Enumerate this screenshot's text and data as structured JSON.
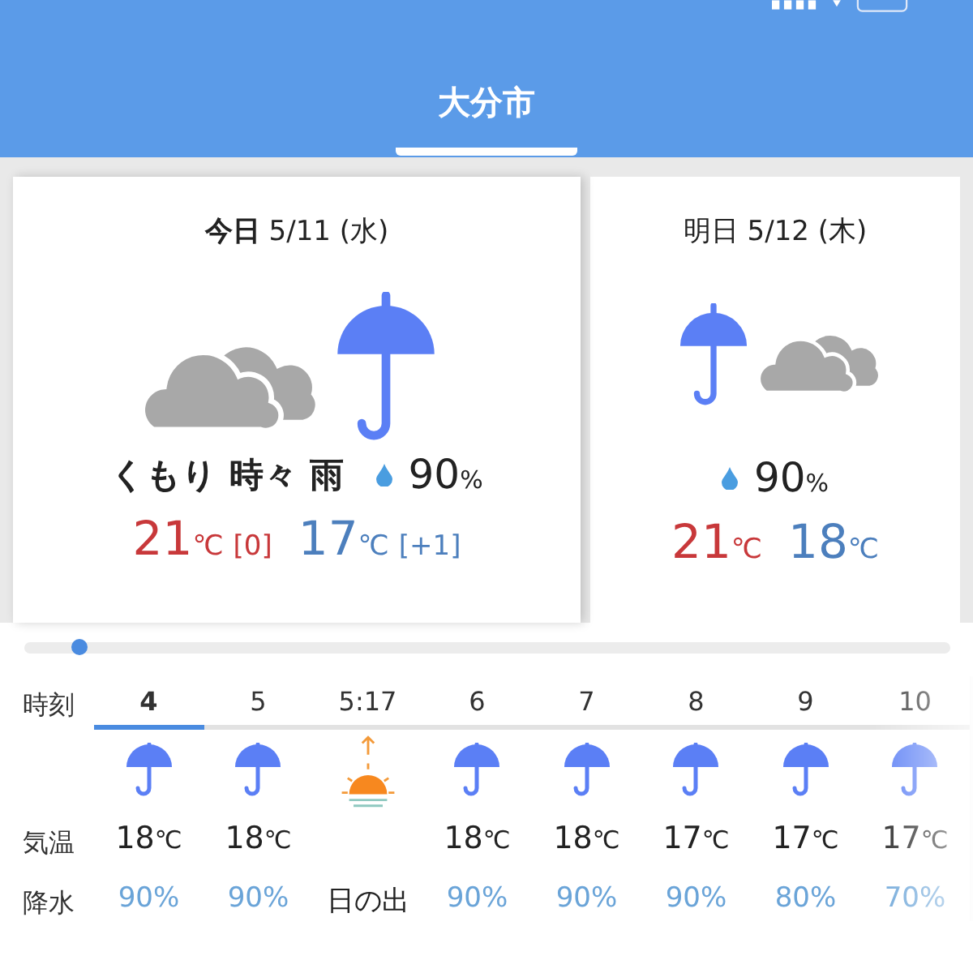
{
  "header": {
    "tabs": [
      {
        "label": "大分市",
        "selected": true
      }
    ]
  },
  "days": [
    {
      "heading": "**今日** 5/11 (水)",
      "icons": [
        {
          "kind": "cloud"
        },
        {
          "kind": "umbrella"
        }
      ],
      "weather": "くもり 時々 雨",
      "precip": "90",
      "precip_unit": "%",
      "high": "21",
      "high_unit": "℃",
      "high_diff": "[0]",
      "low": "17",
      "low_unit": "℃",
      "low_diff": "[+1]"
    },
    {
      "heading": "明日 5/12 (木)",
      "icons": [
        {
          "kind": "umbrella"
        },
        {
          "kind": "cloud"
        }
      ],
      "precip": "90",
      "precip_unit": "%",
      "high": "21",
      "high_unit": "℃",
      "low": "18",
      "low_unit": "℃"
    }
  ],
  "slider": {
    "level": 0.06
  },
  "hourly": {
    "row_labels": [
      "時刻",
      "気温",
      "降水"
    ],
    "hours": [
      {
        "time": "4",
        "kind": "rain",
        "temp": "18",
        "unit": "℃",
        "precip": "90%",
        "selected": true
      },
      {
        "time": "5",
        "kind": "rain",
        "temp": "18",
        "unit": "℃",
        "precip": "90%",
        "selected": false
      },
      {
        "time": "5:17",
        "kind": "sunrise",
        "precip": "日の出",
        "selected": false
      },
      {
        "time": "6",
        "kind": "rain",
        "temp": "18",
        "unit": "℃",
        "precip": "90%",
        "selected": false
      },
      {
        "time": "7",
        "kind": "rain",
        "temp": "18",
        "unit": "℃",
        "precip": "90%",
        "selected": false
      },
      {
        "time": "8",
        "kind": "rain",
        "temp": "17",
        "unit": "℃",
        "precip": "90%",
        "selected": false
      },
      {
        "time": "9",
        "kind": "rain",
        "temp": "17",
        "unit": "℃",
        "precip": "80%",
        "selected": false
      },
      {
        "time": "10",
        "kind": "rain",
        "temp": "17",
        "unit": "℃",
        "precip": "70%",
        "selected": false
      }
    ]
  }
}
